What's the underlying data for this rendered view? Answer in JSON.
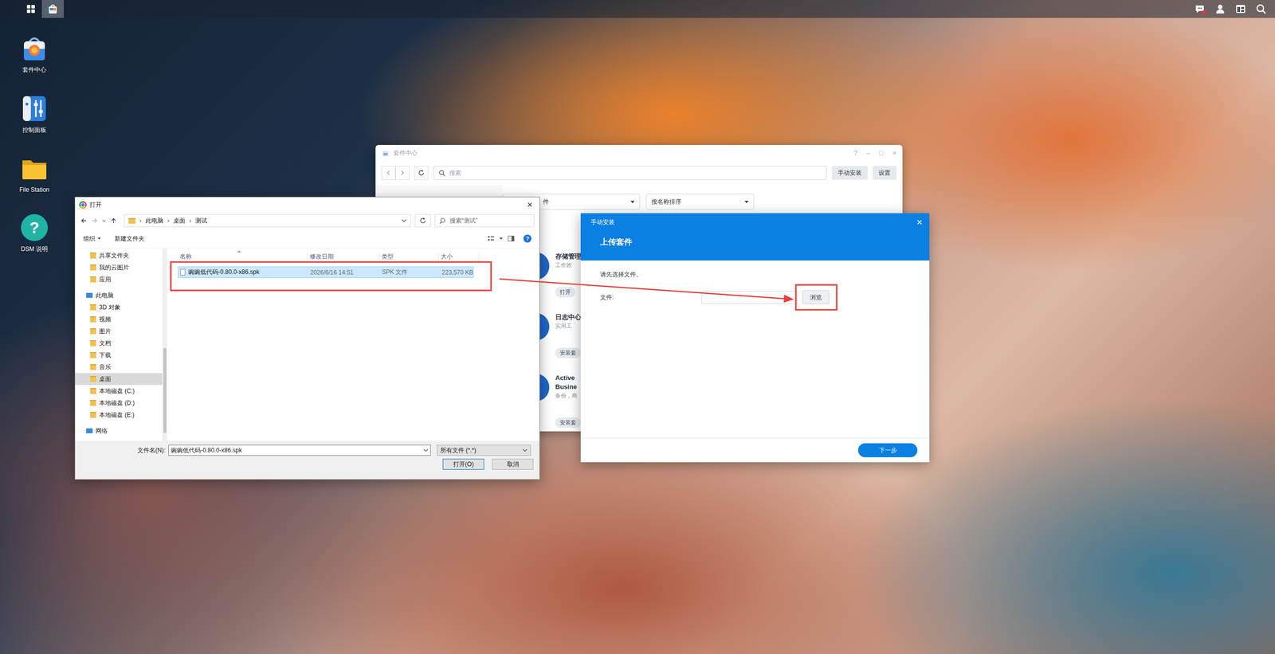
{
  "taskbar": {
    "notification": true
  },
  "desktop_icons": [
    {
      "label": "套件中心",
      "kind": "package",
      "glyph": ""
    },
    {
      "label": "控制面板",
      "kind": "control",
      "glyph": ""
    },
    {
      "label": "File Station",
      "kind": "folder",
      "glyph": ""
    },
    {
      "label": "DSM 说明",
      "kind": "help",
      "glyph": "?"
    }
  ],
  "package_center": {
    "title": "套件中心",
    "controls": [
      "?",
      "–",
      "□",
      "×"
    ],
    "search": {
      "placeholder": "搜索"
    },
    "buttons": [
      "手动安装",
      "设置"
    ],
    "filters": [
      {
        "label": "件"
      },
      {
        "label": "按名称排序"
      }
    ],
    "packages": [
      {
        "name": [
          "存储管理"
        ],
        "desc": "工作效",
        "action": "打开"
      },
      {
        "name": [
          "日志中心"
        ],
        "desc": "实用工",
        "action": "安装套"
      },
      {
        "name": [
          "Active",
          "Busine"
        ],
        "desc": "备份，商",
        "action": "安装套"
      }
    ]
  },
  "file_dialog": {
    "title": "打开",
    "close": "×",
    "path": [
      "此电脑",
      "桌面",
      "测试"
    ],
    "separator": "›",
    "search": {
      "placeholder": "搜索“测试”"
    },
    "toolbar": [
      "组织",
      "新建文件夹"
    ],
    "help": "?",
    "nav": [
      {
        "label": "共享文件夹",
        "kind": "item",
        "selected": false
      },
      {
        "label": "我的云图片",
        "kind": "item",
        "selected": false
      },
      {
        "label": "应用",
        "kind": "item",
        "selected": false
      },
      {
        "label": "此电脑",
        "kind": "group",
        "selected": false
      },
      {
        "label": "3D 对象",
        "kind": "item",
        "selected": false
      },
      {
        "label": "视频",
        "kind": "item",
        "selected": false
      },
      {
        "label": "图片",
        "kind": "item",
        "selected": false
      },
      {
        "label": "文档",
        "kind": "item",
        "selected": false
      },
      {
        "label": "下载",
        "kind": "item",
        "selected": false
      },
      {
        "label": "音乐",
        "kind": "item",
        "selected": false
      },
      {
        "label": "桌面",
        "kind": "item",
        "selected": true
      },
      {
        "label": "本地磁盘 (C:)",
        "kind": "item",
        "selected": false
      },
      {
        "label": "本地磁盘 (D:)",
        "kind": "item",
        "selected": false
      },
      {
        "label": "本地磁盘 (E:)",
        "kind": "item",
        "selected": false
      },
      {
        "label": "网络",
        "kind": "group",
        "selected": false
      }
    ],
    "columns": [
      "名称",
      "修改日期",
      "类型",
      "大小"
    ],
    "files": [
      {
        "name": "豌豌低代码-0.80.0-x86.spk",
        "modified": "2026/6/16 14:51",
        "type": "SPK 文件",
        "size": "223,570 KB",
        "selected": true
      }
    ],
    "filename_label": "文件名(N):",
    "filename": "豌豌低代码-0.80.0-x86.spk",
    "filter": "所有文件 (*.*)",
    "buttons": [
      {
        "label": "打开(O)",
        "primary": true
      },
      {
        "label": "取消",
        "primary": false
      }
    ]
  },
  "install_dialog": {
    "title": "手动安装",
    "close": "×",
    "heading": "上传套件",
    "prompt": "请先选择文件。",
    "file_label": "文件:",
    "file_value": "",
    "browse": "浏览",
    "next": "下一步"
  }
}
